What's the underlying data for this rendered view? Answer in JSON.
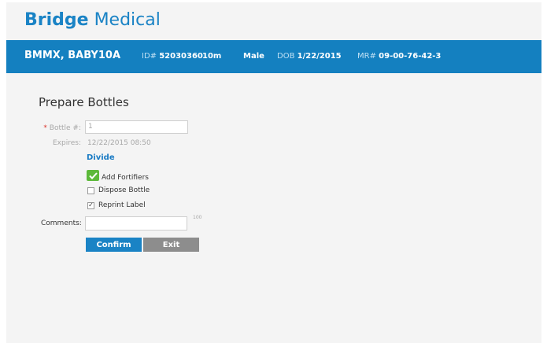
{
  "app": {
    "brand_bold": "Bridge",
    "brand_light": "Medical"
  },
  "patient": {
    "name": "BMMX, BABY10A",
    "id_label": "ID#",
    "id_value": "52030360",
    "age": "10m",
    "sex": "Male",
    "dob_label": "DOB",
    "dob_value": "1/22/2015",
    "mr_label": "MR#",
    "mr_value": "09-00-76-42-3"
  },
  "form": {
    "title": "Prepare Bottles",
    "bottle_required_mark": "*",
    "bottle_label": "Bottle #:",
    "bottle_value": "1",
    "expires_label": "Expires:",
    "expires_value": "12/22/2015 08:50",
    "divide_link": "Divide",
    "options": [
      {
        "label": "Add Fortifiers",
        "checked": true,
        "style": "green"
      },
      {
        "label": "Dispose Bottle",
        "checked": false,
        "style": "box"
      },
      {
        "label": "Reprint Label",
        "checked": true,
        "style": "box"
      }
    ],
    "comments_label": "Comments:",
    "comments_value": "",
    "comments_max": "100",
    "confirm_label": "Confirm",
    "exit_label": "Exit"
  },
  "colors": {
    "brand": "#1a83c5",
    "banner": "#1480c0",
    "confirm": "#1a83c5",
    "exit": "#8d8d8d",
    "fortifier_check": "#5cb93a",
    "required": "#d9342b"
  }
}
